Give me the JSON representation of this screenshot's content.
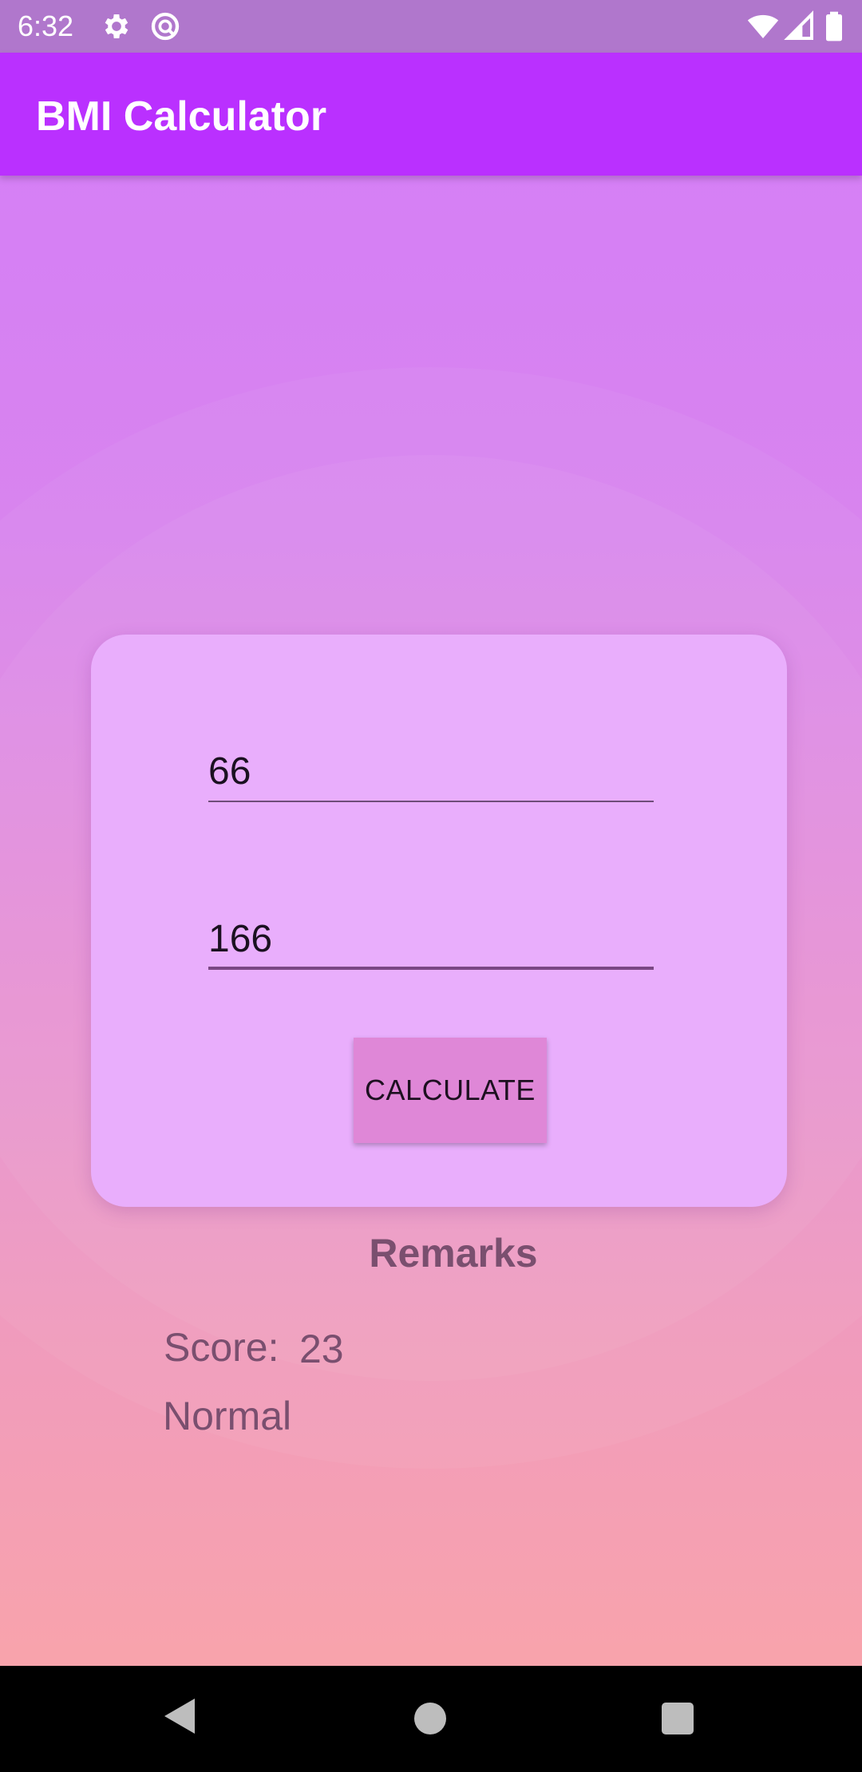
{
  "status_bar": {
    "time": "6:32",
    "icons": [
      "gear-icon",
      "data-saver-icon",
      "wifi-icon",
      "cell-signal-icon",
      "battery-icon"
    ]
  },
  "app_bar": {
    "title": "BMI Calculator",
    "color": "#ba30ff"
  },
  "form": {
    "weight_value": "66",
    "height_value": "166",
    "calculate_label": "CALCULATE"
  },
  "result": {
    "heading": "Remarks",
    "score_label": "Score:",
    "score_value": "23",
    "category": "Normal"
  },
  "nav_bar": {
    "icons": [
      "back-icon",
      "home-icon",
      "recents-icon"
    ]
  },
  "colors": {
    "card": "#e9aefc",
    "button": "#df87d7",
    "text_muted": "#7a4f6f"
  }
}
